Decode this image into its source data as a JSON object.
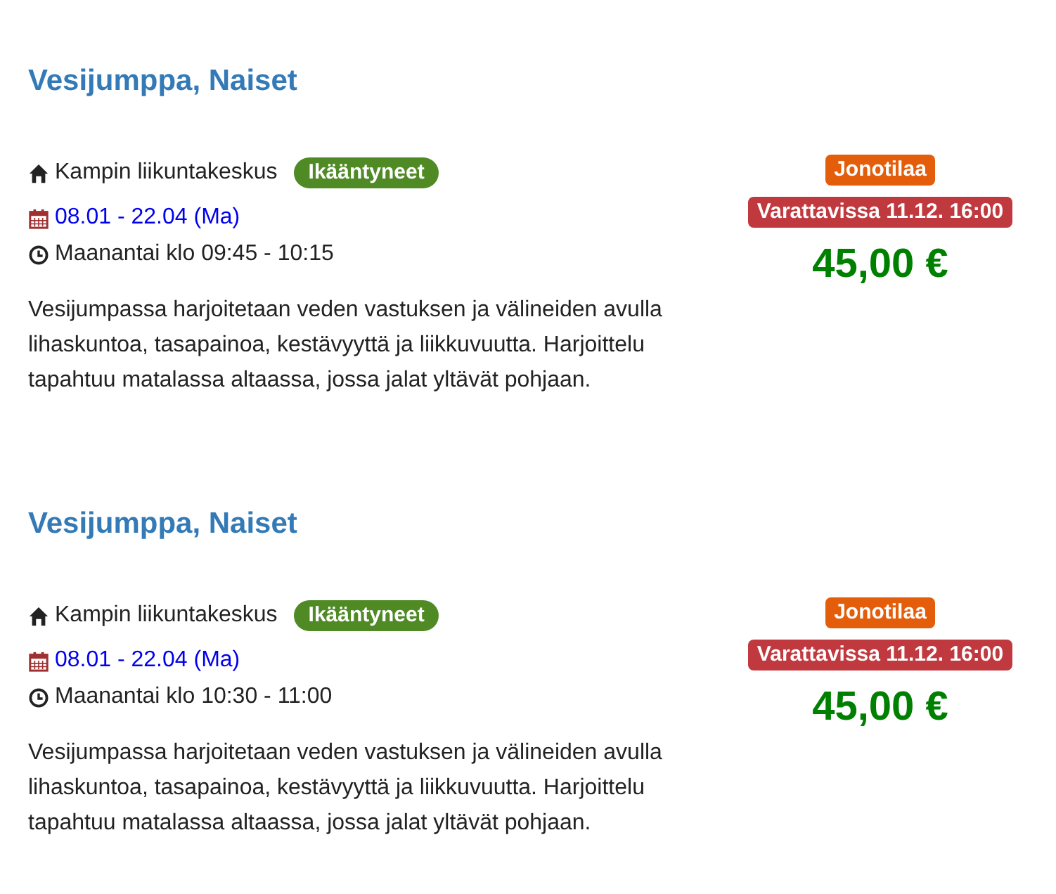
{
  "courses": [
    {
      "title": "Vesijumppa, Naiset",
      "venue": "Kampin liikuntakeskus",
      "tag": "Ikääntyneet",
      "dates": "08.01 - 22.04 (Ma)",
      "schedule": "Maanantai klo 09:45 - 10:15",
      "description": "Vesijumpassa harjoitetaan veden vastuksen ja välineiden avulla lihaskuntoa, tasapainoa, kestävyyttä ja liikkuvuutta. Harjoittelu tapahtuu matalassa altaassa, jossa jalat yltävät pohjaan.",
      "status": "Jonotilaa",
      "availability": "Varattavissa 11.12. 16:00",
      "price": "45,00 €"
    },
    {
      "title": "Vesijumppa, Naiset",
      "venue": "Kampin liikuntakeskus",
      "tag": "Ikääntyneet",
      "dates": "08.01 - 22.04 (Ma)",
      "schedule": "Maanantai klo 10:30 - 11:00",
      "description": "Vesijumpassa harjoitetaan veden vastuksen ja välineiden avulla lihaskuntoa, tasapainoa, kestävyyttä ja liikkuvuutta. Harjoittelu tapahtuu matalassa altaassa, jossa jalat yltävät pohjaan.",
      "status": "Jonotilaa",
      "availability": "Varattavissa 11.12. 16:00",
      "price": "45,00 €"
    }
  ]
}
